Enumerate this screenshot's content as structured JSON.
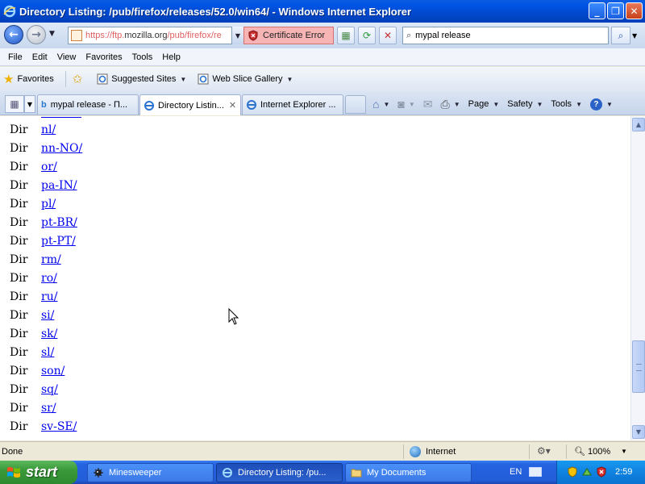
{
  "window": {
    "title": "Directory Listing: /pub/firefox/releases/52.0/win64/ - Windows Internet Explorer",
    "minimize": "_",
    "maximize": "❐",
    "close": "✕"
  },
  "address": {
    "url_prefix": "https://ftp.",
    "url_domain": "mozilla.org",
    "url_suffix": "/pub/firefox/re",
    "cert_error": "Certificate Error",
    "search_value": "mypal release"
  },
  "menu": [
    "File",
    "Edit",
    "View",
    "Favorites",
    "Tools",
    "Help"
  ],
  "favorites_bar": {
    "favorites": "Favorites",
    "suggested": "Suggested Sites",
    "webslice": "Web Slice Gallery"
  },
  "tabs": [
    {
      "label": "mypal release - П..."
    },
    {
      "label": "Directory Listin...",
      "close": "✕"
    },
    {
      "label": "Internet Explorer ..."
    }
  ],
  "command_bar": {
    "page": "Page",
    "safety": "Safety",
    "tools": "Tools"
  },
  "listing": [
    {
      "type": "Dir",
      "name": "nl/"
    },
    {
      "type": "Dir",
      "name": "nn-NO/"
    },
    {
      "type": "Dir",
      "name": "or/"
    },
    {
      "type": "Dir",
      "name": "pa-IN/"
    },
    {
      "type": "Dir",
      "name": "pl/"
    },
    {
      "type": "Dir",
      "name": "pt-BR/"
    },
    {
      "type": "Dir",
      "name": "pt-PT/"
    },
    {
      "type": "Dir",
      "name": "rm/"
    },
    {
      "type": "Dir",
      "name": "ro/"
    },
    {
      "type": "Dir",
      "name": "ru/"
    },
    {
      "type": "Dir",
      "name": "si/"
    },
    {
      "type": "Dir",
      "name": "sk/"
    },
    {
      "type": "Dir",
      "name": "sl/"
    },
    {
      "type": "Dir",
      "name": "son/"
    },
    {
      "type": "Dir",
      "name": "sq/"
    },
    {
      "type": "Dir",
      "name": "sr/"
    },
    {
      "type": "Dir",
      "name": "sv-SE/"
    }
  ],
  "status": {
    "text": "Done",
    "zone": "Internet",
    "zoom": "100%"
  },
  "taskbar": {
    "start": "start",
    "items": [
      {
        "label": "Minesweeper"
      },
      {
        "label": "Directory Listing: /pu..."
      },
      {
        "label": "My Documents"
      }
    ],
    "language": "EN",
    "clock": "2:59"
  },
  "colors": {
    "link": "#0000ee",
    "titlebar": "#0055e5",
    "cert_error_bg": "#f6b4b4"
  }
}
